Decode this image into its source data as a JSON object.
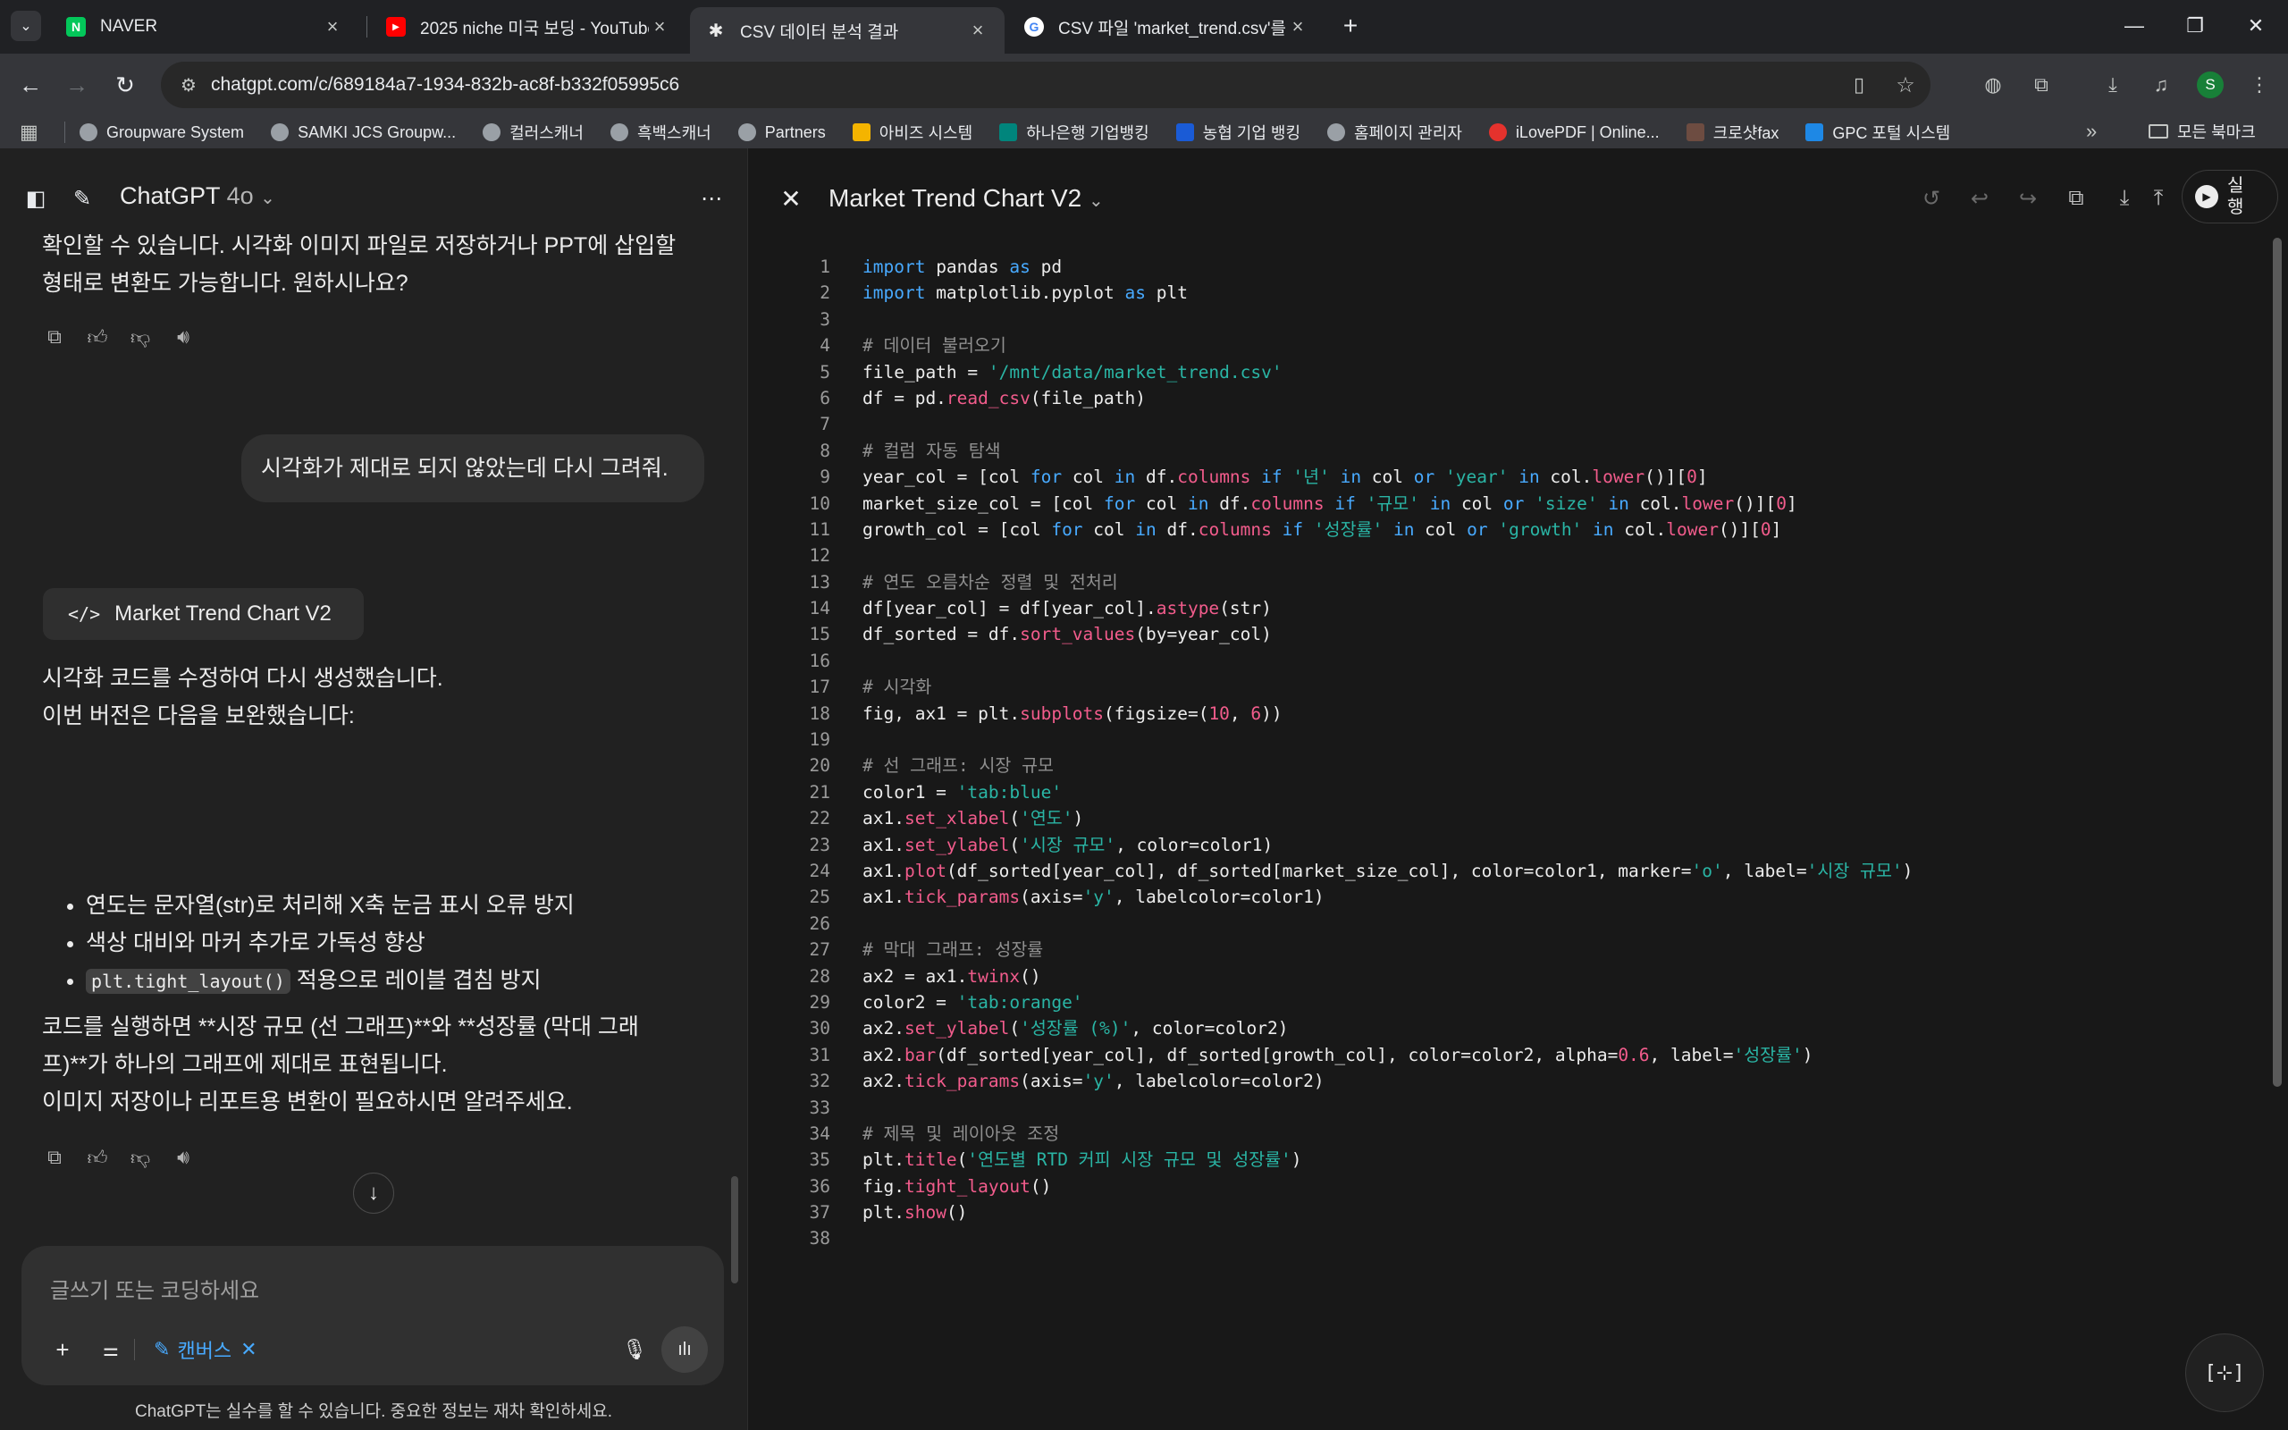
{
  "browser": {
    "tabs": [
      {
        "title": "NAVER",
        "favicon": "naver-icon",
        "favicon_color": "#03c75a",
        "active": false
      },
      {
        "title": "2025 niche 미국 보딩 - YouTube",
        "favicon": "youtube-icon",
        "favicon_color": "#ff0000",
        "active": false
      },
      {
        "title": "CSV 데이터 분석 결과",
        "favicon": "chatgpt-icon",
        "favicon_color": "#ececec",
        "active": true
      },
      {
        "title": "CSV 파일 'market_trend.csv'를",
        "favicon": "google-icon",
        "favicon_color": "#4285f4",
        "active": false
      }
    ],
    "url": "chatgpt.com/c/689184a7-1934-832b-ac8f-b332f05995c6",
    "profile_initial": "S",
    "bookmarks": [
      {
        "label": "Groupware System",
        "icon": "globe-icon"
      },
      {
        "label": "SAMKI JCS Groupw...",
        "icon": "globe-icon"
      },
      {
        "label": "컬러스캐너",
        "icon": "globe-icon"
      },
      {
        "label": "흑백스캐너",
        "icon": "globe-icon"
      },
      {
        "label": "Partners",
        "icon": "globe-icon"
      },
      {
        "label": "아비즈 시스템",
        "icon": "abiz-icon"
      },
      {
        "label": "하나은행 기업뱅킹",
        "icon": "hana-icon"
      },
      {
        "label": "농협 기업 뱅킹",
        "icon": "nh-icon"
      },
      {
        "label": "홈페이지 관리자",
        "icon": "globe-icon"
      },
      {
        "label": "iLovePDF | Online...",
        "icon": "ilovepdf-icon"
      },
      {
        "label": "크로샷fax",
        "icon": "fax-icon"
      },
      {
        "label": "GPC 포털 시스템",
        "icon": "gpc-icon"
      }
    ],
    "all_bookmarks_label": "모든 북마크"
  },
  "chat": {
    "model_name": "ChatGPT",
    "model_version": "4o",
    "prev_answer_line1": "확인할 수 있습니다. 시각화 이미지 파일로 저장하거나 PPT에 삽입할",
    "prev_answer_line2": "형태로 변환도 가능합니다. 원하시나요?",
    "user_message": "시각화가 제대로 되지 않았는데 다시 그려줘.",
    "canvas_chip_label": "Market Trend Chart V2",
    "answer_intro_1": "시각화 코드를 수정하여 다시 생성했습니다.",
    "answer_intro_2": "이번 버전은 다음을 보완했습니다:",
    "bullet_1": "연도는 문자열(str)로 처리해 X축 눈금 표시 오류 방지",
    "bullet_2": "색상 대비와 마커 추가로 가독성 향상",
    "bullet_3_code": "plt.tight_layout()",
    "bullet_3_text": " 적용으로 레이블 겹침 방지",
    "answer_body_1": "코드를 실행하면 **시장 규모 (선 그래프)**와 **성장률 (막대 그래",
    "answer_body_2": "프)**가 하나의 그래프에 제대로 표현됩니다.",
    "answer_body_3": "이미지 저장이나 리포트용 변환이 필요하시면 알려주세요.",
    "composer_placeholder": "글쓰기 또는 코딩하세요",
    "canvas_tag_label": "캔버스",
    "disclaimer": "ChatGPT는 실수를 할 수 있습니다. 중요한 정보는 재차 확인하세요."
  },
  "canvas": {
    "title": "Market Trend Chart V2",
    "run_label": "실행",
    "code_lines": [
      [
        [
          "kw",
          "import"
        ],
        [
          "p",
          " pandas "
        ],
        [
          "kw",
          "as"
        ],
        [
          "p",
          " pd"
        ]
      ],
      [
        [
          "kw",
          "import"
        ],
        [
          "p",
          " matplotlib.pyplot "
        ],
        [
          "kw",
          "as"
        ],
        [
          "p",
          " plt"
        ]
      ],
      [],
      [
        [
          "cm",
          "# 데이터 불러오기"
        ]
      ],
      [
        [
          "p",
          "file_path = "
        ],
        [
          "str",
          "'/mnt/data/market_trend.csv'"
        ]
      ],
      [
        [
          "p",
          "df = pd."
        ],
        [
          "fn",
          "read_csv"
        ],
        [
          "p",
          "(file_path)"
        ]
      ],
      [],
      [
        [
          "cm",
          "# 컬럼 자동 탐색"
        ]
      ],
      [
        [
          "p",
          "year_col = [col "
        ],
        [
          "kw",
          "for"
        ],
        [
          "p",
          " col "
        ],
        [
          "kw",
          "in"
        ],
        [
          "p",
          " df."
        ],
        [
          "fn",
          "columns"
        ],
        [
          "p",
          " "
        ],
        [
          "kw",
          "if"
        ],
        [
          "p",
          " "
        ],
        [
          "str",
          "'년'"
        ],
        [
          "p",
          " "
        ],
        [
          "kw",
          "in"
        ],
        [
          "p",
          " col "
        ],
        [
          "kw",
          "or"
        ],
        [
          "p",
          " "
        ],
        [
          "str",
          "'year'"
        ],
        [
          "p",
          " "
        ],
        [
          "kw",
          "in"
        ],
        [
          "p",
          " col."
        ],
        [
          "fn",
          "lower"
        ],
        [
          "p",
          "()]["
        ],
        [
          "num",
          "0"
        ],
        [
          "p",
          "]"
        ]
      ],
      [
        [
          "p",
          "market_size_col = [col "
        ],
        [
          "kw",
          "for"
        ],
        [
          "p",
          " col "
        ],
        [
          "kw",
          "in"
        ],
        [
          "p",
          " df."
        ],
        [
          "fn",
          "columns"
        ],
        [
          "p",
          " "
        ],
        [
          "kw",
          "if"
        ],
        [
          "p",
          " "
        ],
        [
          "str",
          "'규모'"
        ],
        [
          "p",
          " "
        ],
        [
          "kw",
          "in"
        ],
        [
          "p",
          " col "
        ],
        [
          "kw",
          "or"
        ],
        [
          "p",
          " "
        ],
        [
          "str",
          "'size'"
        ],
        [
          "p",
          " "
        ],
        [
          "kw",
          "in"
        ],
        [
          "p",
          " col."
        ],
        [
          "fn",
          "lower"
        ],
        [
          "p",
          "()]["
        ],
        [
          "num",
          "0"
        ],
        [
          "p",
          "]"
        ]
      ],
      [
        [
          "p",
          "growth_col = [col "
        ],
        [
          "kw",
          "for"
        ],
        [
          "p",
          " col "
        ],
        [
          "kw",
          "in"
        ],
        [
          "p",
          " df."
        ],
        [
          "fn",
          "columns"
        ],
        [
          "p",
          " "
        ],
        [
          "kw",
          "if"
        ],
        [
          "p",
          " "
        ],
        [
          "str",
          "'성장률'"
        ],
        [
          "p",
          " "
        ],
        [
          "kw",
          "in"
        ],
        [
          "p",
          " col "
        ],
        [
          "kw",
          "or"
        ],
        [
          "p",
          " "
        ],
        [
          "str",
          "'growth'"
        ],
        [
          "p",
          " "
        ],
        [
          "kw",
          "in"
        ],
        [
          "p",
          " col."
        ],
        [
          "fn",
          "lower"
        ],
        [
          "p",
          "()]["
        ],
        [
          "num",
          "0"
        ],
        [
          "p",
          "]"
        ]
      ],
      [],
      [
        [
          "cm",
          "# 연도 오름차순 정렬 및 전처리"
        ]
      ],
      [
        [
          "p",
          "df[year_col] = df[year_col]."
        ],
        [
          "fn",
          "astype"
        ],
        [
          "p",
          "(str)"
        ]
      ],
      [
        [
          "p",
          "df_sorted = df."
        ],
        [
          "fn",
          "sort_values"
        ],
        [
          "p",
          "(by=year_col)"
        ]
      ],
      [],
      [
        [
          "cm",
          "# 시각화"
        ]
      ],
      [
        [
          "p",
          "fig, ax1 = plt."
        ],
        [
          "fn",
          "subplots"
        ],
        [
          "p",
          "(figsize=("
        ],
        [
          "num",
          "10"
        ],
        [
          "p",
          ", "
        ],
        [
          "num",
          "6"
        ],
        [
          "p",
          "))"
        ]
      ],
      [],
      [
        [
          "cm",
          "# 선 그래프: 시장 규모"
        ]
      ],
      [
        [
          "p",
          "color1 = "
        ],
        [
          "str",
          "'tab:blue'"
        ]
      ],
      [
        [
          "p",
          "ax1."
        ],
        [
          "fn",
          "set_xlabel"
        ],
        [
          "p",
          "("
        ],
        [
          "str",
          "'연도'"
        ],
        [
          "p",
          ")"
        ]
      ],
      [
        [
          "p",
          "ax1."
        ],
        [
          "fn",
          "set_ylabel"
        ],
        [
          "p",
          "("
        ],
        [
          "str",
          "'시장 규모'"
        ],
        [
          "p",
          ", color=color1)"
        ]
      ],
      [
        [
          "p",
          "ax1."
        ],
        [
          "fn",
          "plot"
        ],
        [
          "p",
          "(df_sorted[year_col], df_sorted[market_size_col], color=color1, marker="
        ],
        [
          "str",
          "'o'"
        ],
        [
          "p",
          ", label="
        ],
        [
          "str",
          "'시장 규모'"
        ],
        [
          "p",
          ")"
        ]
      ],
      [
        [
          "p",
          "ax1."
        ],
        [
          "fn",
          "tick_params"
        ],
        [
          "p",
          "(axis="
        ],
        [
          "str",
          "'y'"
        ],
        [
          "p",
          ", labelcolor=color1)"
        ]
      ],
      [],
      [
        [
          "cm",
          "# 막대 그래프: 성장률"
        ]
      ],
      [
        [
          "p",
          "ax2 = ax1."
        ],
        [
          "fn",
          "twinx"
        ],
        [
          "p",
          "()"
        ]
      ],
      [
        [
          "p",
          "color2 = "
        ],
        [
          "str",
          "'tab:orange'"
        ]
      ],
      [
        [
          "p",
          "ax2."
        ],
        [
          "fn",
          "set_ylabel"
        ],
        [
          "p",
          "("
        ],
        [
          "str",
          "'성장률 (%)'"
        ],
        [
          "p",
          ", color=color2)"
        ]
      ],
      [
        [
          "p",
          "ax2."
        ],
        [
          "fn",
          "bar"
        ],
        [
          "p",
          "(df_sorted[year_col], df_sorted[growth_col], color=color2, alpha="
        ],
        [
          "num",
          "0.6"
        ],
        [
          "p",
          ", label="
        ],
        [
          "str",
          "'성장률'"
        ],
        [
          "p",
          ")"
        ]
      ],
      [
        [
          "p",
          "ax2."
        ],
        [
          "fn",
          "tick_params"
        ],
        [
          "p",
          "(axis="
        ],
        [
          "str",
          "'y'"
        ],
        [
          "p",
          ", labelcolor=color2)"
        ]
      ],
      [],
      [
        [
          "cm",
          "# 제목 및 레이아웃 조정"
        ]
      ],
      [
        [
          "p",
          "plt."
        ],
        [
          "fn",
          "title"
        ],
        [
          "p",
          "("
        ],
        [
          "str",
          "'연도별 RTD 커피 시장 규모 및 성장률'"
        ],
        [
          "p",
          ")"
        ]
      ],
      [
        [
          "p",
          "fig."
        ],
        [
          "fn",
          "tight_layout"
        ],
        [
          "p",
          "()"
        ]
      ],
      [
        [
          "p",
          "plt."
        ],
        [
          "fn",
          "show"
        ],
        [
          "p",
          "()"
        ]
      ],
      []
    ]
  }
}
